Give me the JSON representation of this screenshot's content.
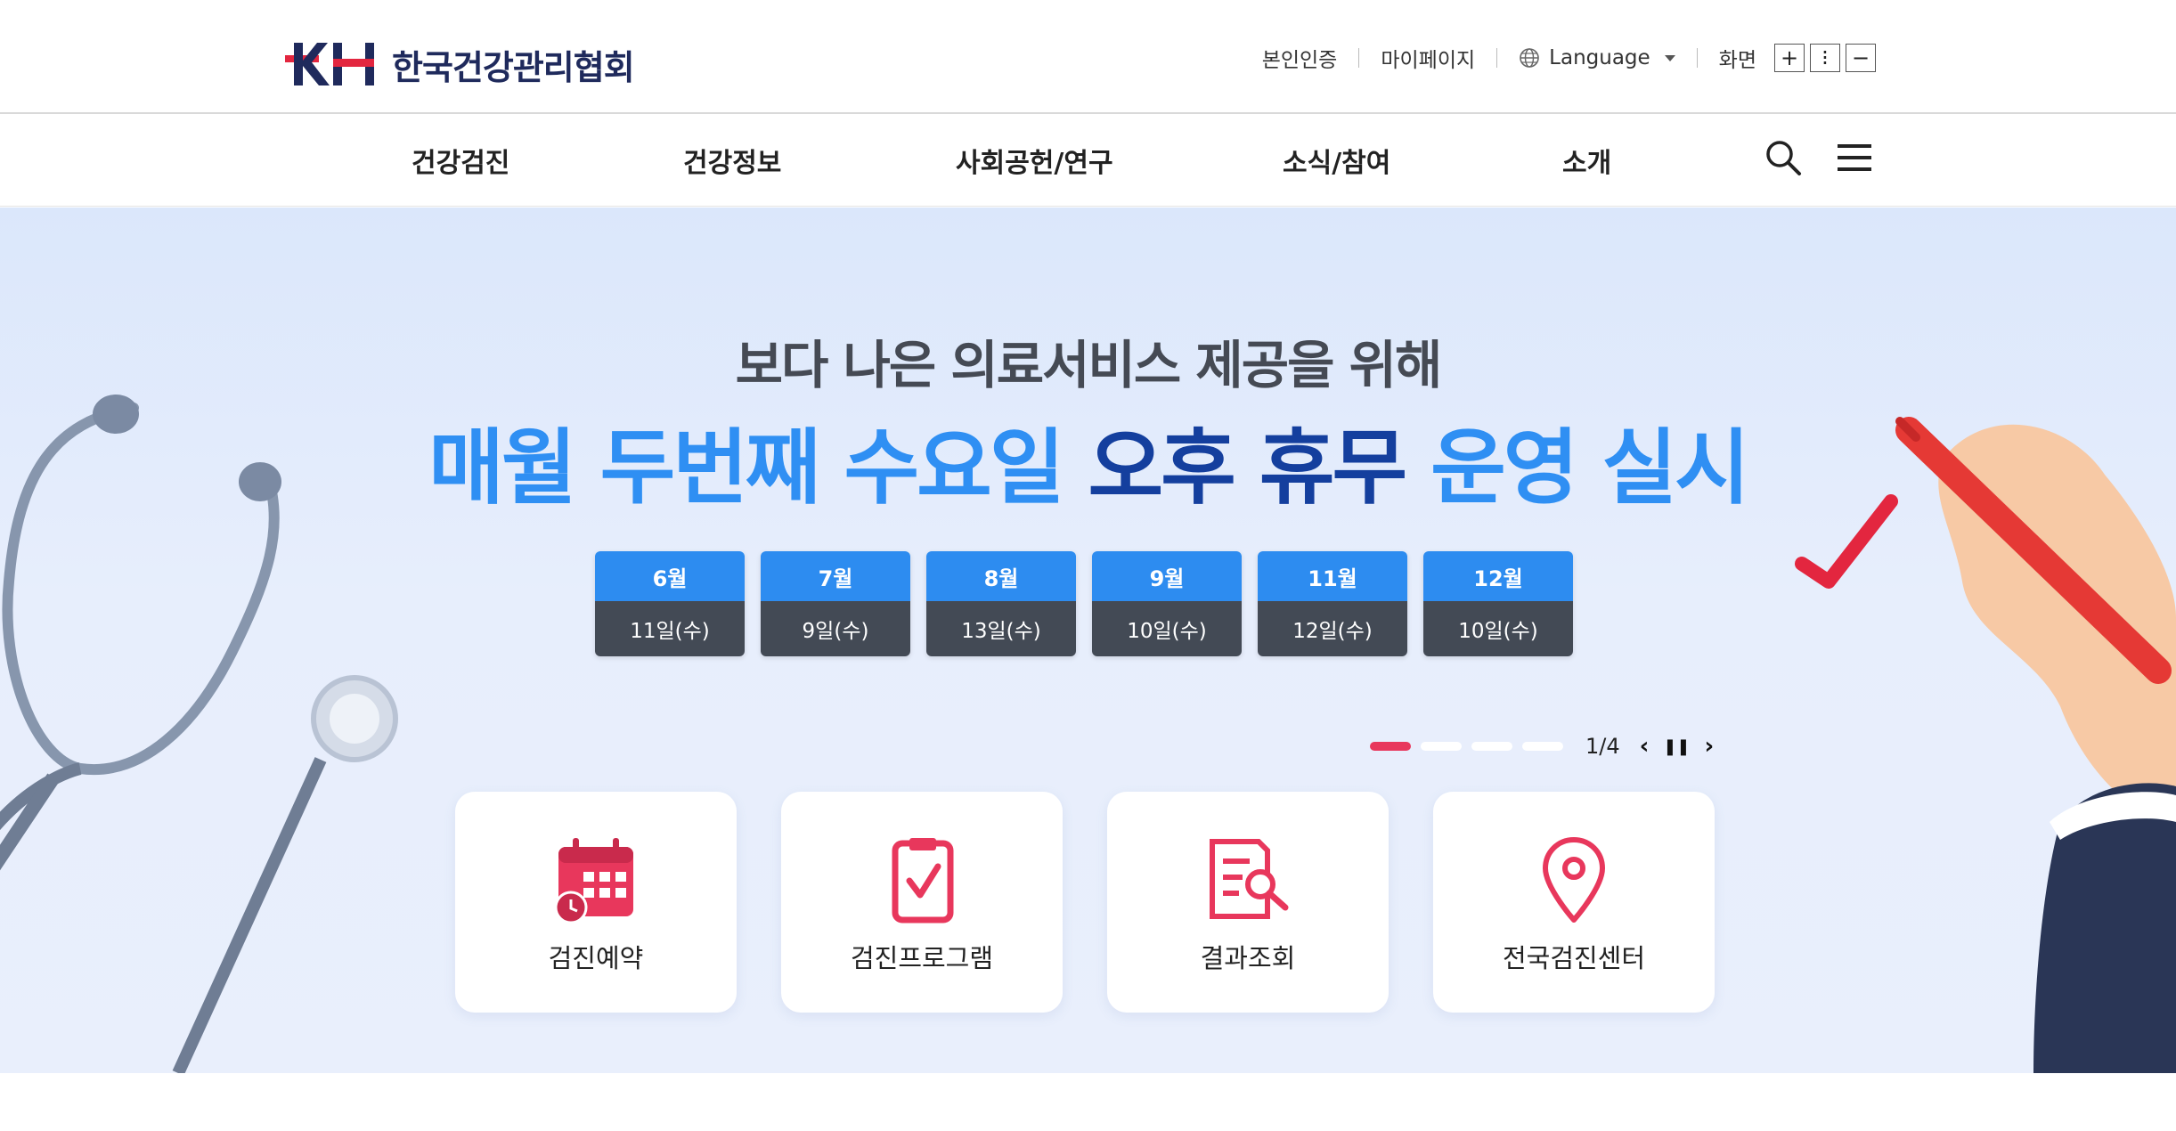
{
  "header": {
    "logo_mark": "KH",
    "logo_text": "한국건강관리협회",
    "util_links": [
      "본인인증",
      "마이페이지"
    ],
    "language_label": "Language",
    "screen_label": "화면",
    "zoom_in": "+",
    "zoom_reset": "⁝",
    "zoom_out": "−"
  },
  "nav": {
    "items": [
      "건강검진",
      "건강정보",
      "사회공헌/연구",
      "소식/참여",
      "소개"
    ],
    "search_icon": "search-icon",
    "menu_icon": "hamburger-menu-icon"
  },
  "hero": {
    "subtitle": "보다 나은 의료서비스 제공을 위해",
    "headline_part1": "매월 두번째 수요일",
    "headline_part2": "오후 휴무",
    "headline_part3": "운영 실시",
    "dates": [
      {
        "month": "6월",
        "day": "11일(수)"
      },
      {
        "month": "7월",
        "day": "9일(수)"
      },
      {
        "month": "8월",
        "day": "13일(수)"
      },
      {
        "month": "9월",
        "day": "10일(수)"
      },
      {
        "month": "11월",
        "day": "12일(수)"
      },
      {
        "month": "12월",
        "day": "10일(수)"
      }
    ],
    "slide_counter": "1/4",
    "prev_label": "‹",
    "pause_label": "❚❚",
    "next_label": "›",
    "accent_colors": {
      "light_blue": "#2f8ff3",
      "dark_blue": "#143f9e",
      "pink": "#e8375c"
    }
  },
  "quick_links": [
    {
      "label": "검진예약",
      "icon": "calendar-clock-icon"
    },
    {
      "label": "검진프로그램",
      "icon": "clipboard-check-icon"
    },
    {
      "label": "결과조회",
      "icon": "document-search-icon"
    },
    {
      "label": "전국검진센터",
      "icon": "location-pin-icon"
    }
  ]
}
